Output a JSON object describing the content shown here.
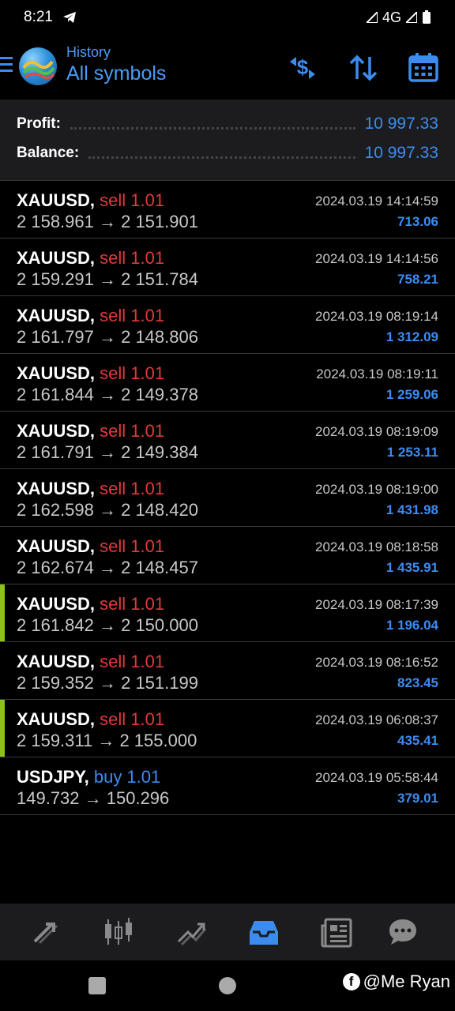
{
  "status_bar": {
    "time": "8:21",
    "network": "4G"
  },
  "header": {
    "subtitle": "History",
    "title": "All symbols"
  },
  "summary": {
    "profit_label": "Profit:",
    "profit_value": "10 997.33",
    "balance_label": "Balance:",
    "balance_value": "10 997.33"
  },
  "trades": [
    {
      "symbol": "XAUUSD,",
      "type": "sell 1.01",
      "side": "sell",
      "prices": "2 158.961 → 2 151.901",
      "time": "2024.03.19 14:14:59",
      "profit": "713.06",
      "marked": false
    },
    {
      "symbol": "XAUUSD,",
      "type": "sell 1.01",
      "side": "sell",
      "prices": "2 159.291 → 2 151.784",
      "time": "2024.03.19 14:14:56",
      "profit": "758.21",
      "marked": false
    },
    {
      "symbol": "XAUUSD,",
      "type": "sell 1.01",
      "side": "sell",
      "prices": "2 161.797 → 2 148.806",
      "time": "2024.03.19 08:19:14",
      "profit": "1 312.09",
      "marked": false
    },
    {
      "symbol": "XAUUSD,",
      "type": "sell 1.01",
      "side": "sell",
      "prices": "2 161.844 → 2 149.378",
      "time": "2024.03.19 08:19:11",
      "profit": "1 259.06",
      "marked": false
    },
    {
      "symbol": "XAUUSD,",
      "type": "sell 1.01",
      "side": "sell",
      "prices": "2 161.791 → 2 149.384",
      "time": "2024.03.19 08:19:09",
      "profit": "1 253.11",
      "marked": false
    },
    {
      "symbol": "XAUUSD,",
      "type": "sell 1.01",
      "side": "sell",
      "prices": "2 162.598 → 2 148.420",
      "time": "2024.03.19 08:19:00",
      "profit": "1 431.98",
      "marked": false
    },
    {
      "symbol": "XAUUSD,",
      "type": "sell 1.01",
      "side": "sell",
      "prices": "2 162.674 → 2 148.457",
      "time": "2024.03.19 08:18:58",
      "profit": "1 435.91",
      "marked": false
    },
    {
      "symbol": "XAUUSD,",
      "type": "sell 1.01",
      "side": "sell",
      "prices": "2 161.842 → 2 150.000",
      "time": "2024.03.19 08:17:39",
      "profit": "1 196.04",
      "marked": true
    },
    {
      "symbol": "XAUUSD,",
      "type": "sell 1.01",
      "side": "sell",
      "prices": "2 159.352 → 2 151.199",
      "time": "2024.03.19 08:16:52",
      "profit": "823.45",
      "marked": false
    },
    {
      "symbol": "XAUUSD,",
      "type": "sell 1.01",
      "side": "sell",
      "prices": "2 159.311 → 2 155.000",
      "time": "2024.03.19 06:08:37",
      "profit": "435.41",
      "marked": true
    },
    {
      "symbol": "USDJPY,",
      "type": "buy 1.01",
      "side": "buy",
      "prices": "149.732 → 150.296",
      "time": "2024.03.19 05:58:44",
      "profit": "379.01",
      "marked": false
    }
  ],
  "icons": {
    "header": [
      "currency-exchange-icon",
      "sort-icon",
      "calendar-icon"
    ],
    "tabs": [
      "quotes-icon",
      "chart-candles-icon",
      "trade-icon",
      "history-icon",
      "news-icon",
      "chat-icon"
    ]
  },
  "colors": {
    "accent": "#3c8cf0",
    "sell": "#e03a3a",
    "marker": "#8bc21c",
    "active_tab": "#3c8cf0",
    "inactive_tab": "#8a8a8a"
  },
  "watermark": {
    "text": "@Me Ryan"
  }
}
